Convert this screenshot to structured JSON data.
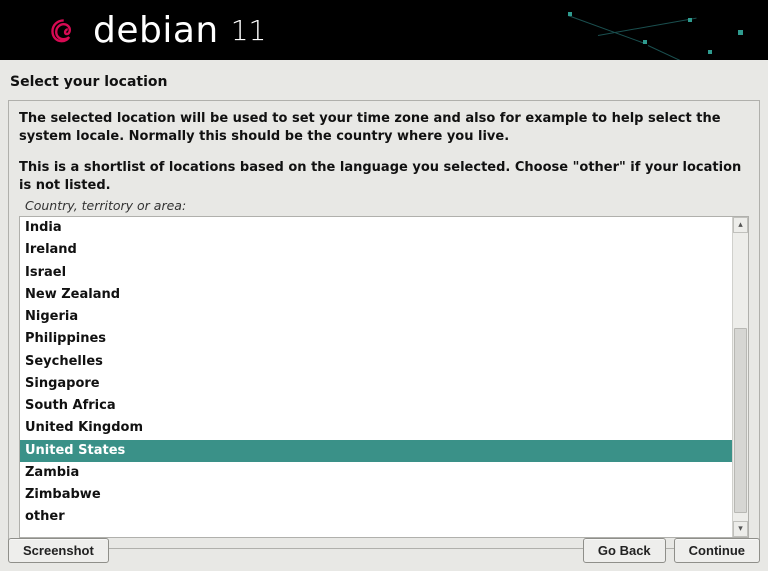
{
  "brand": {
    "name": "debian",
    "version": "11"
  },
  "page_title": "Select your location",
  "instructions": {
    "p1": "The selected location will be used to set your time zone and also for example to help select the system locale. Normally this should be the country where you live.",
    "p2": "This is a shortlist of locations based on the language you selected. Choose \"other\" if your location is not listed."
  },
  "field_label": "Country, territory or area:",
  "locations": [
    "India",
    "Ireland",
    "Israel",
    "New Zealand",
    "Nigeria",
    "Philippines",
    "Seychelles",
    "Singapore",
    "South Africa",
    "United Kingdom",
    "United States",
    "Zambia",
    "Zimbabwe",
    "other"
  ],
  "selected_location": "United States",
  "buttons": {
    "screenshot": "Screenshot",
    "go_back": "Go Back",
    "continue": "Continue"
  }
}
